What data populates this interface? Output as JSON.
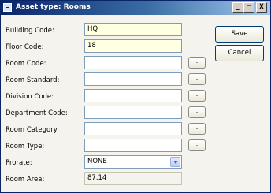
{
  "window": {
    "title": "Asset type: Rooms",
    "minimize_label": "_",
    "maximize_label": "□",
    "close_label": "X"
  },
  "actions": {
    "save_label": "Save",
    "cancel_label": "Cancel"
  },
  "lookup_label": "...",
  "fields": [
    {
      "label": "Building Code:",
      "value": "HQ"
    },
    {
      "label": "Floor Code:",
      "value": "18"
    },
    {
      "label": "Room Code:",
      "value": ""
    },
    {
      "label": "Room Standard:",
      "value": ""
    },
    {
      "label": "Division Code:",
      "value": ""
    },
    {
      "label": "Department Code:",
      "value": ""
    },
    {
      "label": "Room Category:",
      "value": ""
    },
    {
      "label": "Room Type:",
      "value": ""
    },
    {
      "label": "Prorate:",
      "value": "NONE"
    },
    {
      "label": "Room Area:",
      "value": "87.14"
    }
  ]
}
